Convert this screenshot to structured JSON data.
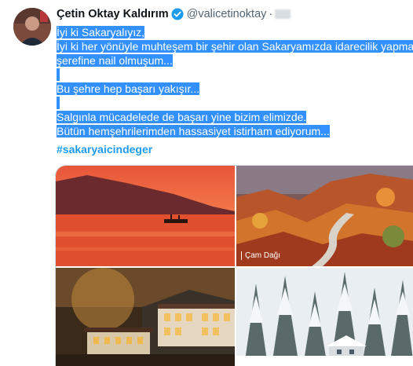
{
  "user": {
    "name": "Çetin Oktay Kaldırım",
    "handle": "@valicetinoktay",
    "separator": "·"
  },
  "tweet": {
    "lines": [
      "İyi ki Sakaryalıyız,",
      "İyi ki her yönüyle muhteşem bir şehir olan Sakaryamızda idarecilik yapma",
      "şerefine nail olmuşum...",
      "",
      "Bu şehre hep başarı yakışır...",
      "",
      "Salgınla mücadelede de başarı yine bizim elimizde.",
      "Bütün hemşehrilerimden hassasiyet istirham ediyorum..."
    ],
    "hashtag": "#sakaryaicindeger"
  },
  "media": {
    "tile2_caption": "Çam Dağı"
  },
  "colors": {
    "selection": "#3390ff",
    "link": "#1d9bf0",
    "verified": "#1d9bf0"
  }
}
